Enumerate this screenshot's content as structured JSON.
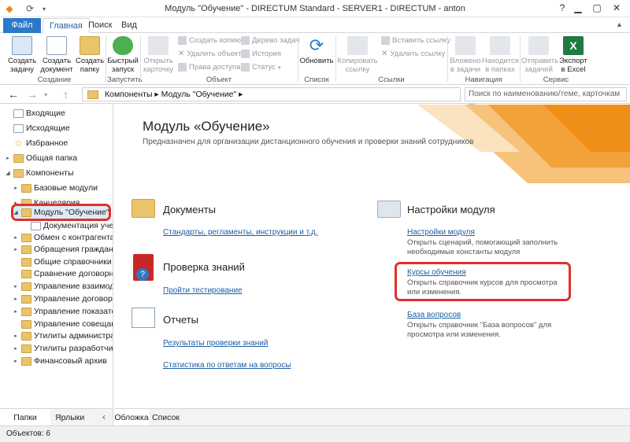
{
  "window": {
    "title": "Модуль \"Обучение\" - DIRECTUM Standard - SERVER1 - DIRECTUM - anton"
  },
  "tabs": [
    {
      "label": "Файл"
    },
    {
      "label": "Главная"
    },
    {
      "label": "Поиск"
    },
    {
      "label": "Вид"
    }
  ],
  "ribbon": {
    "create_task": "Создать задачу",
    "create_doc": "Создать документ",
    "create_folder": "Создать папку",
    "group_create": "Создание",
    "quick_run": "Быстрый запуск",
    "group_run": "Запустить",
    "open_card": "Открыть карточку",
    "create_copy": "Создать копию",
    "delete_obj": "Удалить объект",
    "access_rights": "Права доступа",
    "task_tree": "Дерево задач",
    "history": "История",
    "status": "Статус",
    "group_object": "Объект",
    "refresh": "Обновить",
    "group_list": "Список",
    "copy_link": "Копировать ссылку",
    "paste_link": "Вставить ссылку",
    "delete_link": "Удалить ссылку",
    "group_links": "Ссылки",
    "nested_in_tasks": "Вложено в задачи",
    "located_in_folders": "Находится в папках",
    "group_navigation": "Навигация",
    "send_task": "Отправить задачей",
    "export_excel": "Экспорт в Excel",
    "group_service": "Сервис"
  },
  "navbar": {
    "address": "Компоненты ▸ Модуль \"Обучение\" ▸",
    "search_placeholder": "Поиск по наименованию/теме, карточкам ..."
  },
  "tree": {
    "items": [
      {
        "label": "Входящие"
      },
      {
        "label": "Исходящие"
      },
      {
        "label": "Избранное"
      },
      {
        "label": "Общая папка"
      },
      {
        "label": "Компоненты"
      },
      {
        "label": "Базовые модули"
      },
      {
        "label": "Канцелярия"
      },
      {
        "label": "Модуль \"Обучение\""
      },
      {
        "label": "Документация учеб..."
      },
      {
        "label": "Обмен с контрагентами"
      },
      {
        "label": "Обращения граждан и..."
      },
      {
        "label": "Общие справочники"
      },
      {
        "label": "Сравнение договорны..."
      },
      {
        "label": "Управление взаимоде..."
      },
      {
        "label": "Управление договора..."
      },
      {
        "label": "Управление показател..."
      },
      {
        "label": "Управление совещани..."
      },
      {
        "label": "Утилиты администрат..."
      },
      {
        "label": "Утилиты разработчика"
      },
      {
        "label": "Финансовый архив"
      }
    ],
    "bottom_tabs": [
      "Папки",
      "Ярлыки"
    ]
  },
  "main": {
    "title": "Модуль «Обучение»",
    "subtitle": "Предназначен для организации дистанционного обучения и проверки знаний сотрудников",
    "sections": {
      "documents": {
        "title": "Документы",
        "link": "Стандарты, регламенты, инструкции и т.д."
      },
      "knowledge": {
        "title": "Проверка знаний",
        "link": "Пройти тестирование"
      },
      "reports": {
        "title": "Отчеты",
        "link1": "Результаты проверки знаний",
        "link2": "Статистика по ответам на вопросы"
      },
      "settings": {
        "title": "Настройки модуля",
        "link1": "Настройки модуля",
        "desc1": "Открыть сценарий, помогающий заполнить необходимые константы модуля",
        "link2": "Курсы обучения",
        "desc2": "Открыть справочник курсов для просмотра или изменения.",
        "link3": "База вопросов",
        "desc3": "Открыть справочник \"База вопросов\" для просмотра или изменения."
      }
    },
    "bottom_tabs": [
      "Обложка",
      "Список"
    ]
  },
  "status": {
    "text": "Объектов: 6"
  },
  "colors": {
    "accent": "#2b79c8",
    "highlight": "#e0302a",
    "banner": "#f39a1e"
  }
}
